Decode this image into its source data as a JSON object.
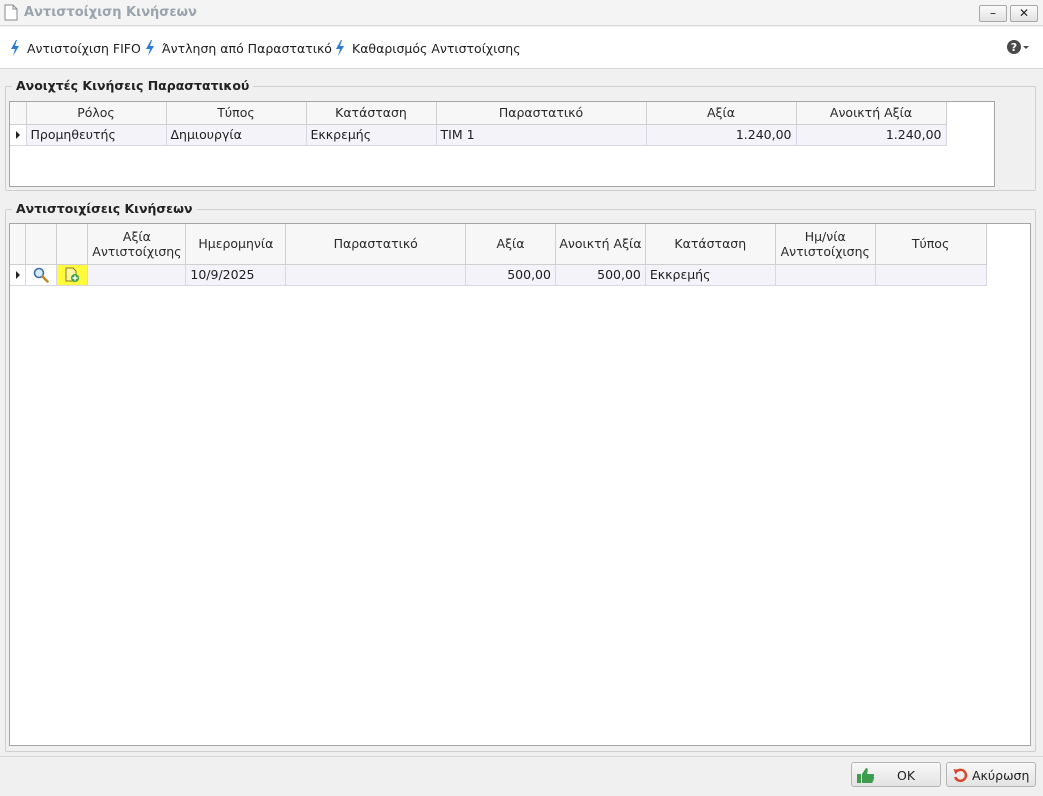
{
  "window": {
    "title": "Αντιστοίχιση Κινήσεων",
    "minimize_glyph": "–",
    "close_glyph": "✕"
  },
  "toolbar": {
    "items": [
      {
        "label": "Αντιστοίχιση FIFO",
        "icon": "lightning-icon"
      },
      {
        "label": "Άντληση από Παραστατικό",
        "icon": "lightning-icon"
      },
      {
        "label": "Καθαρισμός Αντιστοίχισης",
        "icon": "lightning-icon"
      }
    ],
    "help_icon": "help-dropdown-icon"
  },
  "open_movements": {
    "title": "Ανοιχτές Κινήσεις Παραστατικού",
    "columns": [
      "Ρόλος",
      "Τύπος",
      "Κατάσταση",
      "Παραστατικό",
      "Αξία",
      "Ανοικτή Αξία"
    ],
    "rows": [
      {
        "role": "Προμηθευτής",
        "type": "Δημιουργία",
        "status": "Εκκρεμής",
        "document": "ΤΙΜ 1",
        "value": "1.240,00",
        "open_value": "1.240,00"
      }
    ]
  },
  "matchings": {
    "title": "Αντιστοιχίσεις Κινήσεων",
    "columns": [
      "Αξία Αντιστοίχισης",
      "Ημερομηνία",
      "Παραστατικό",
      "Αξία",
      "Ανοικτή Αξία",
      "Κατάσταση",
      "Ημ/νία Αντιστοίχισης",
      "Τύπος"
    ],
    "rows": [
      {
        "matched_value": "",
        "date": "10/9/2025",
        "document": "",
        "value": "500,00",
        "open_value": "500,00",
        "status": "Εκκρεμής",
        "match_date": "",
        "type": ""
      }
    ],
    "row_icons": [
      "magnifier-icon",
      "add-document-icon"
    ],
    "highlight_color": "#fffa3c"
  },
  "footer": {
    "ok_label": "OK",
    "cancel_label": "Ακύρωση"
  },
  "colors": {
    "lightning": "#2e7bd6",
    "ok_icon": "#3e9c4e",
    "cancel_icon": "#d9452b"
  }
}
